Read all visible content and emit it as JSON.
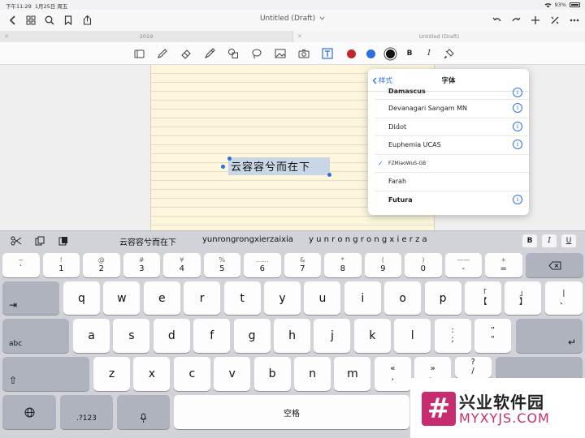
{
  "status_bar": {
    "time": "下午11:29",
    "date": "1月25日 周五",
    "battery": "93%"
  },
  "nav": {
    "title": "Untitled (Draft)"
  },
  "tabs": [
    {
      "label": "2019"
    },
    {
      "label": "Untitled (Draft)"
    }
  ],
  "toolbar": {
    "colors": {
      "red": "#c0272d",
      "blue": "#2e6fe0",
      "black": "#111111"
    },
    "bold_label": "B",
    "italic_label": "I"
  },
  "editor": {
    "text": "云容容兮而在下"
  },
  "font_popover": {
    "back_label": "样式",
    "title": "字体",
    "fonts": [
      {
        "name": "Damascus",
        "selected": false,
        "info": true
      },
      {
        "name": "Devanagari Sangam MN",
        "selected": false,
        "info": true
      },
      {
        "name": "Didot",
        "selected": false,
        "info": true
      },
      {
        "name": "Euphemia UCAS",
        "selected": false,
        "info": true
      },
      {
        "name": "FZMiaoWuS-GB",
        "selected": true,
        "info": false
      },
      {
        "name": "Farah",
        "selected": false,
        "info": false
      },
      {
        "name": "Futura",
        "selected": false,
        "info": true
      }
    ]
  },
  "candidates": {
    "items": [
      "云容容兮而在下",
      "yunrongrongxierzaixia",
      "y u n r o n g r o n g x i e r z a"
    ],
    "bold": "B",
    "italic": "I",
    "underline": "U"
  },
  "keyboard": {
    "row_numbers": [
      {
        "top": "~",
        "bot": "`"
      },
      {
        "top": "!",
        "bot": "1"
      },
      {
        "top": "@",
        "bot": "2"
      },
      {
        "top": "#",
        "bot": "3"
      },
      {
        "top": "¥",
        "bot": "4"
      },
      {
        "top": "%",
        "bot": "5"
      },
      {
        "top": "……",
        "bot": "6"
      },
      {
        "top": "&",
        "bot": "7"
      },
      {
        "top": "*",
        "bot": "8"
      },
      {
        "top": "(",
        "bot": "9"
      },
      {
        "top": ")",
        "bot": "0"
      },
      {
        "top": "——",
        "bot": "-"
      },
      {
        "top": "+",
        "bot": "="
      }
    ],
    "row_q": [
      "q",
      "w",
      "e",
      "r",
      "t",
      "y",
      "u",
      "i",
      "o",
      "p"
    ],
    "row_q_extra": [
      {
        "top": "「",
        "bot": "【"
      },
      {
        "top": "」",
        "bot": "】"
      },
      {
        "top": "|",
        "bot": "、"
      }
    ],
    "row_a": [
      "a",
      "s",
      "d",
      "f",
      "g",
      "h",
      "j",
      "k",
      "l"
    ],
    "row_a_extra": [
      {
        "top": ":",
        "bot": ";"
      },
      {
        "top": "”",
        "bot": "“"
      }
    ],
    "row_z": [
      "z",
      "x",
      "c",
      "v",
      "b",
      "n",
      "m"
    ],
    "row_z_extra": [
      {
        "top": "«",
        "bot": ","
      },
      {
        "top": "»",
        "bot": "。"
      },
      {
        "top": "?",
        "bot": "/"
      }
    ],
    "tab_key": "⇥",
    "caps_key": "abc",
    "shift_key": "⇧",
    "num_key": ".?123",
    "space_key": "空格",
    "delete_key": "⌫",
    "return_key": "↵"
  },
  "watermark": {
    "title": "兴业软件园",
    "url": "MYXYJS.COM"
  }
}
